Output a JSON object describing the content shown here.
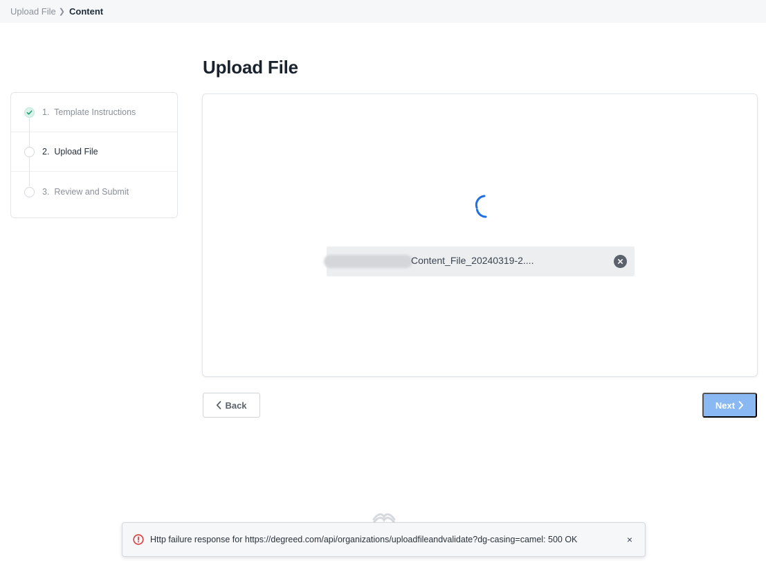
{
  "breadcrumb": {
    "parent": "Upload File",
    "current": "Content"
  },
  "page_title": "Upload File",
  "steps": [
    {
      "number": "1.",
      "label": "Template Instructions",
      "state": "complete"
    },
    {
      "number": "2.",
      "label": "Upload File",
      "state": "active"
    },
    {
      "number": "3.",
      "label": "Review and Submit",
      "state": "pending"
    }
  ],
  "upload": {
    "file_name_visible": "Content_File_20240319-2....",
    "status": "loading",
    "remove_icon": "close-circle-icon"
  },
  "buttons": {
    "back": "Back",
    "next": "Next"
  },
  "toast": {
    "message": "Http failure response for https://degreed.com/api/organizations/uploadfileandvalidate?dg-casing=camel: 500 OK",
    "close": "×",
    "icon": "error-circle-icon"
  },
  "colors": {
    "accent": "#1f6fe0",
    "next_disabled": "#8ab8f3",
    "success": "#1d9e6e",
    "error": "#d93a3a"
  }
}
